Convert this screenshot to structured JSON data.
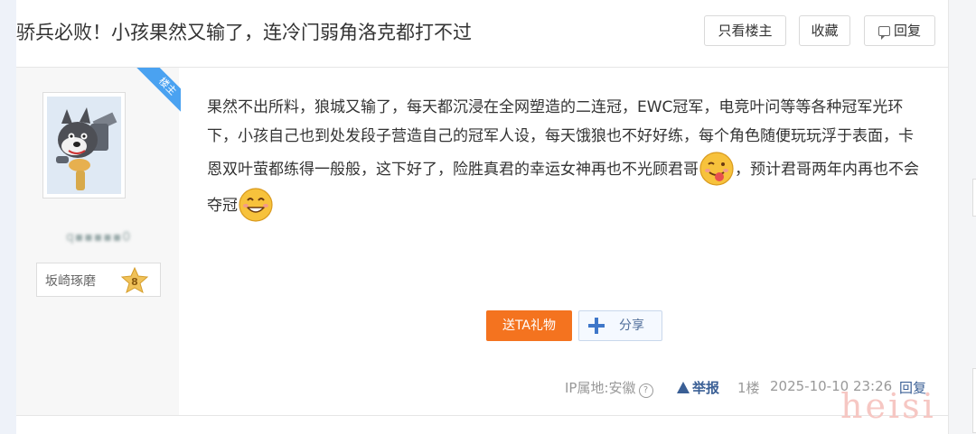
{
  "header": {
    "title": "骄兵必败！小孩果然又输了，连冷门弱角洛克都打不过",
    "only_op_label": "只看楼主",
    "favorite_label": "收藏",
    "reply_label": "回复"
  },
  "author": {
    "op_ribbon": "楼主",
    "username": "q▪▪▪▪▪0",
    "badge_name": "坂崎琢磨",
    "badge_level": "8"
  },
  "post": {
    "text_part1": "果然不出所料，狼城又输了，每天都沉浸在全网塑造的二连冠，EWC冠军，电竞叶问等等各种冠军光环下，小孩自己也到处发段子营造自己的冠军人设，每天饿狼也不好好练，每个角色随便玩玩浮于表面，卡恩双叶萤都练得一般般，这下好了，险胜真君的幸运女神再也不光顾君哥",
    "text_part2": "，预计君哥两年内再也不会夺冠",
    "emoji1": "tongue-out-emoji",
    "emoji2": "smile-emoji"
  },
  "actions": {
    "gift_label": "送TA礼物",
    "share_label": "分享"
  },
  "meta": {
    "ip_label": "IP属地:安徽",
    "report_label": "举报",
    "floor": "1楼",
    "timestamp": "2025-10-10 23:26",
    "reply_label": "回复"
  },
  "watermark": "heisi",
  "colors": {
    "accent_orange": "#f4731f",
    "link_blue": "#3a5f95",
    "op_ribbon": "#4aa2f1"
  }
}
